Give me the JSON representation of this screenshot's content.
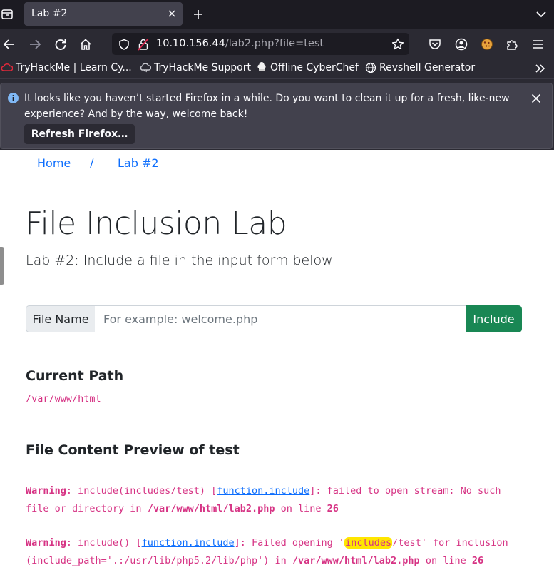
{
  "browser": {
    "tab_title": "Lab #2",
    "url_host": "10.10.156.44",
    "url_path": "/lab2.php?file=test",
    "bookmarks": [
      {
        "label": "TryHackMe | Learn Cy...",
        "icon": "tryhackme-icon"
      },
      {
        "label": "TryHackMe Support",
        "icon": "cloud-icon"
      },
      {
        "label": "Offline CyberChef",
        "icon": "chef-hat-icon"
      },
      {
        "label": "Revshell Generator",
        "icon": "globe-icon"
      }
    ],
    "notification": {
      "text": "It looks like you haven’t started Firefox in a while. Do you want to clean it up for a fresh, like-new experience? And by the way, welcome back!",
      "button_label": "Refresh Firefox…"
    }
  },
  "page": {
    "breadcrumb": {
      "home": "Home",
      "separator": "/",
      "current": "Lab #2"
    },
    "title": "File Inclusion Lab",
    "subtitle": "Lab #2: Include a file in the input form below",
    "form": {
      "label": "File Name",
      "placeholder": "For example: welcome.php",
      "value": "",
      "button_label": "Include"
    },
    "current_path": {
      "heading": "Current Path",
      "value": "/var/www/html"
    },
    "preview": {
      "heading": "File Content Preview of test",
      "warning1": {
        "label": "Warning",
        "text_a": ": include(includes/test) [",
        "link": "function.include",
        "text_b": "]: failed to open stream: No such file or directory in ",
        "file": "/var/www/html/lab2.php",
        "text_c": " on line ",
        "line": "26"
      },
      "warning2": {
        "label": "Warning",
        "text_a": ": include() [",
        "link": "function.include",
        "text_b": "]: Failed opening '",
        "highlight": "includes",
        "text_c": "/test' for inclusion (include_path='.:/usr/lib/php5.2/lib/php') in ",
        "file": "/var/www/html/lab2.php",
        "text_d": " on line ",
        "line": "26"
      }
    }
  }
}
